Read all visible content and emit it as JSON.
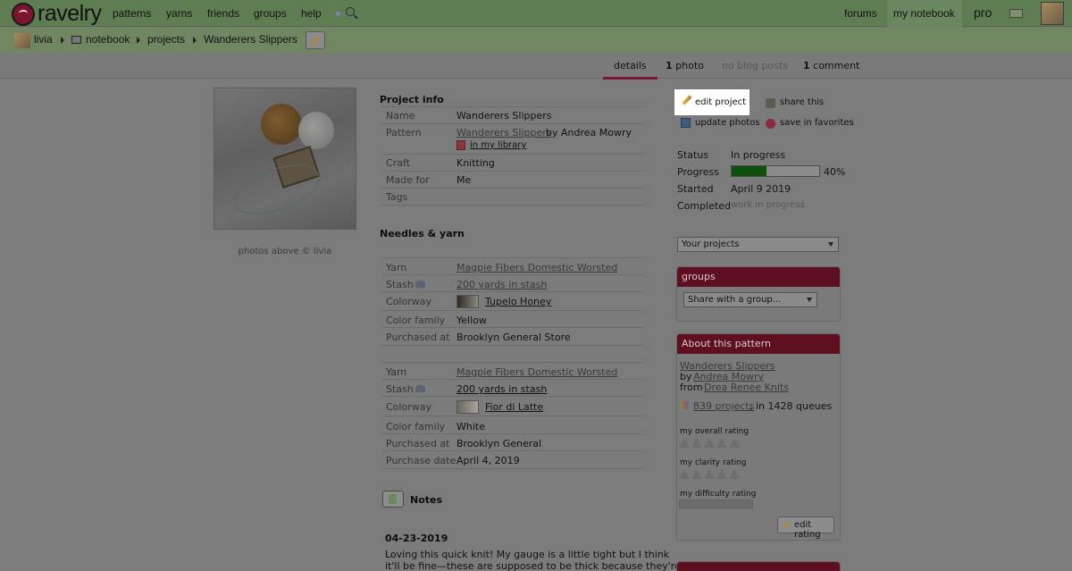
{
  "topnav": {
    "brand": "ravelry",
    "left_items": [
      "patterns",
      "yarns",
      "friends",
      "groups",
      "help"
    ],
    "right_items": [
      "forums",
      "my notebook",
      "pro"
    ]
  },
  "breadcrumb": {
    "user": "livia",
    "notebook": "notebook",
    "projects": "projects",
    "project": "Wanderers Slippers"
  },
  "tabs": [
    {
      "label": "details",
      "active": true
    },
    {
      "count": "1",
      "label": "photo"
    },
    {
      "label": "no blog posts",
      "disabled": true
    },
    {
      "count": "1",
      "label": "comment"
    }
  ],
  "photo_caption": "photos above © livia",
  "project_info": {
    "heading": "Project info",
    "rows": [
      {
        "label": "Name",
        "value": "Wanderers Slippers"
      },
      {
        "label": "Pattern",
        "value": "Wanderers Slippers",
        "by": "by Andrea Mowry",
        "library": "in my library"
      },
      {
        "label": "Craft",
        "value": "Knitting"
      },
      {
        "label": "Made for",
        "value": "Me"
      },
      {
        "label": "Tags",
        "value": ""
      }
    ]
  },
  "needles_yarn": {
    "heading": "Needles & yarn",
    "yarns": [
      {
        "yarn": "Magpie Fibers Domestic Worsted",
        "stash": "200 yards in stash",
        "colorway": "Tupelo Honey",
        "color_family": "Yellow",
        "purchased_at": "Brooklyn General Store"
      },
      {
        "yarn": "Magpie Fibers Domestic Worsted",
        "stash": "200 yards in stash",
        "colorway": "Fior di Latte",
        "color_family": "White",
        "purchased_at": "Brooklyn General",
        "purchase_date": "April 4, 2019"
      }
    ],
    "labels": {
      "yarn": "Yarn",
      "stash": "Stash",
      "colorway": "Colorway",
      "color_family": "Color family",
      "purchased_at": "Purchased at",
      "purchase_date": "Purchase date"
    }
  },
  "notes": {
    "heading": "Notes",
    "date": "04-23-2019",
    "line1": "Loving this quick knit! My gauge is a little tight but I think",
    "line2": "it'll be fine—these are supposed to be thick because they're"
  },
  "actions": {
    "edit_project": "edit project",
    "share_this": "share this",
    "update_photos": "update photos",
    "save_favorites": "save in favorites"
  },
  "status": {
    "status_label": "Status",
    "status_value": "In progress",
    "progress_label": "Progress",
    "progress_percent": 40,
    "progress_text": "40%",
    "started_label": "Started",
    "started_value": "April 9 2019",
    "completed_label": "Completed",
    "completed_value": "work in progress"
  },
  "your_projects_select": "Your projects",
  "groups_panel": {
    "title": "groups",
    "select": "Share with a group..."
  },
  "about_pattern": {
    "title": "About this pattern",
    "pattern": "Wanderers Slippers",
    "by": "by",
    "designer": "Andrea Mowry",
    "from": "from",
    "source": "Drea Renee Knits",
    "projects_link": "839 projects",
    "queues": ", in 1428 queues",
    "overall_rating": "my overall rating",
    "clarity_rating": "my clarity rating",
    "difficulty_rating": "my difficulty rating",
    "edit_rating": "edit rating"
  },
  "colors": {
    "topbar": "#5f7d52",
    "breadcrumb": "#6f8660",
    "page_bg": "#7b7b7b",
    "panel_header": "#5e1020",
    "progress_fill": "#0d4f0d",
    "tab_underline": "#7a1a36"
  }
}
